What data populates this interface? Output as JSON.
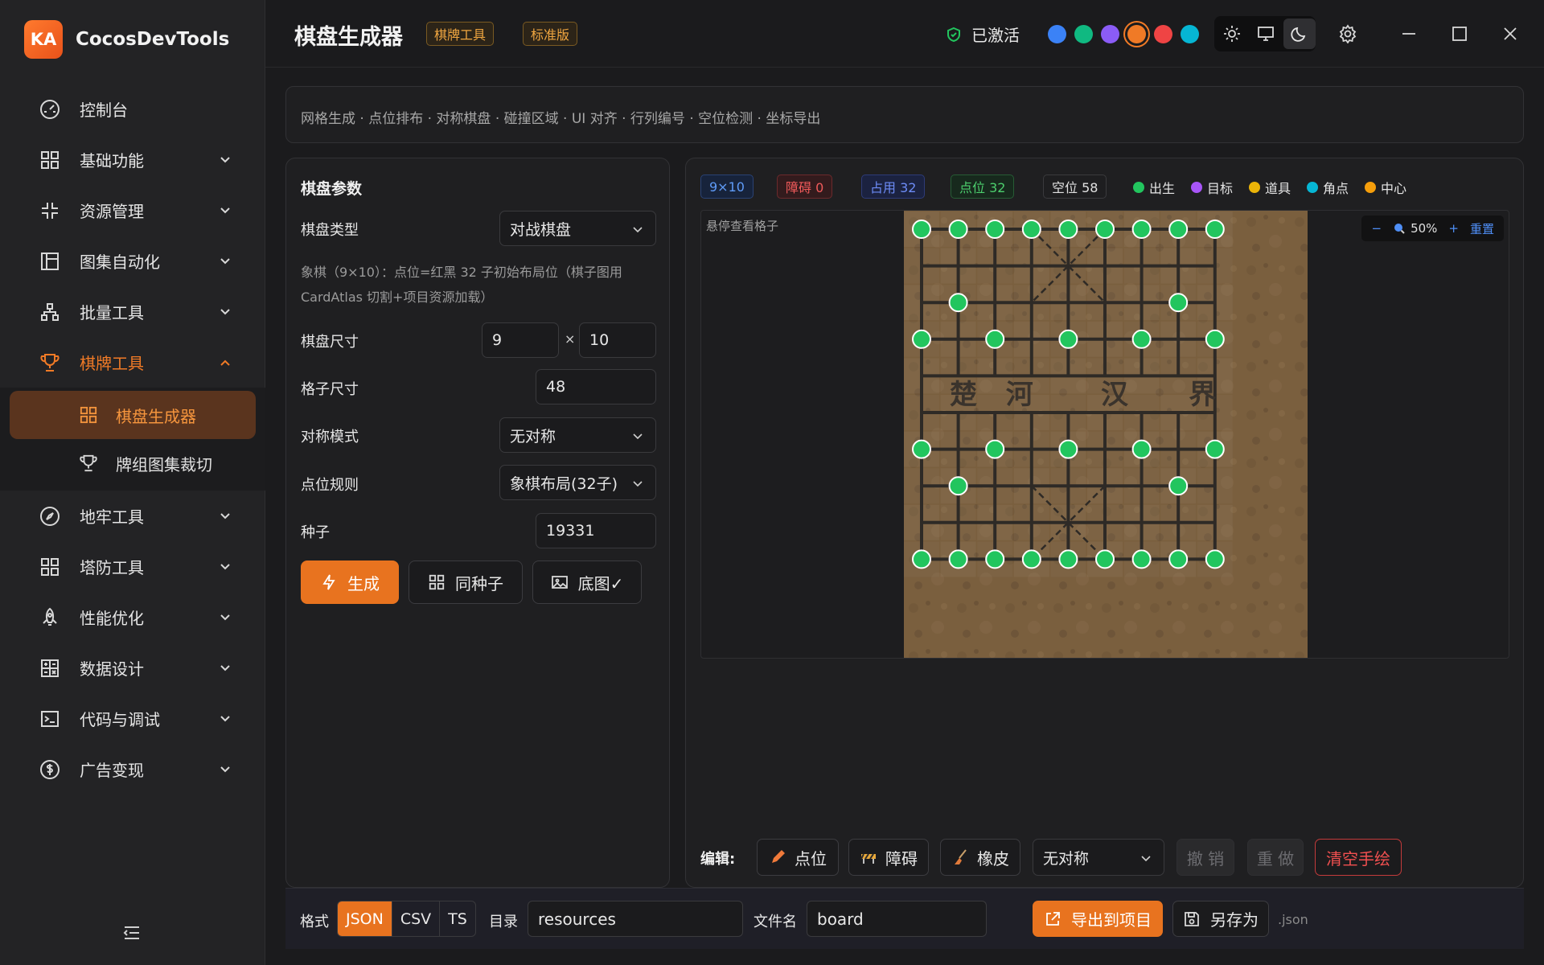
{
  "app": {
    "logo_text": "KA",
    "name": "CocosDevTools"
  },
  "sidebar": {
    "items": [
      {
        "label": "控制台",
        "icon": "dashboard-icon"
      },
      {
        "label": "基础功能",
        "icon": "grid-icon"
      },
      {
        "label": "资源管理",
        "icon": "shrink-icon"
      },
      {
        "label": "图集自动化",
        "icon": "layout-icon"
      },
      {
        "label": "批量工具",
        "icon": "hierarchy-icon"
      },
      {
        "label": "棋牌工具",
        "icon": "trophy-icon"
      },
      {
        "label": "地牢工具",
        "icon": "compass-icon"
      },
      {
        "label": "塔防工具",
        "icon": "grid-icon"
      },
      {
        "label": "性能优化",
        "icon": "rocket-icon"
      },
      {
        "label": "数据设计",
        "icon": "calculator-icon"
      },
      {
        "label": "代码与调试",
        "icon": "terminal-icon"
      },
      {
        "label": "广告变现",
        "icon": "dollar-icon"
      }
    ],
    "subitems": [
      {
        "label": "棋盘生成器",
        "icon": "grid-icon"
      },
      {
        "label": "牌组图集裁切",
        "icon": "trophy-icon"
      }
    ]
  },
  "header": {
    "title": "棋盘生成器",
    "tags": [
      "棋牌工具",
      "标准版"
    ],
    "status": "已激活",
    "swatches": [
      "#3b82f6",
      "#10b981",
      "#8b5cf6",
      "#f07a26",
      "#ef4444",
      "#06b6d4"
    ]
  },
  "features": "网格生成 · 点位排布 · 对称棋盘 · 碰撞区域 · UI 对齐 · 行列编号 · 空位检测 · 坐标导出",
  "params": {
    "title": "棋盘参数",
    "type_label": "棋盘类型",
    "type_value": "对战棋盘",
    "desc": "象棋（9×10）：点位=红黑 32 子初始布局位（棋子图用 CardAtlas 切割+项目资源加载）",
    "size_label": "棋盘尺寸",
    "size_w": "9",
    "size_x": "×",
    "size_h": "10",
    "cell_label": "格子尺寸",
    "cell_value": "48",
    "sym_label": "对称模式",
    "sym_value": "无对称",
    "rule_label": "点位规则",
    "rule_value": "象棋布局(32子)",
    "seed_label": "种子",
    "seed_value": "19331",
    "btn_generate": "生成",
    "btn_same_seed": "同种子",
    "btn_bg": "底图✓"
  },
  "stats": {
    "dims": "9×10",
    "obstacles": "障碍 0",
    "occupied": "占用 32",
    "points": "点位 32",
    "empty": "空位 58"
  },
  "legend": [
    {
      "label": "出生",
      "color": "#22c55e"
    },
    {
      "label": "目标",
      "color": "#a855f7"
    },
    {
      "label": "道具",
      "color": "#eab308"
    },
    {
      "label": "角点",
      "color": "#06b6d4"
    },
    {
      "label": "中心",
      "color": "#f59e0b"
    }
  ],
  "canvas": {
    "hover_hint": "悬停查看格子",
    "zoom_minus": "−",
    "zoom_value": "50%",
    "zoom_plus": "+",
    "zoom_reset": "重置",
    "river_text": [
      "楚",
      "河",
      "汉",
      "界"
    ]
  },
  "edit": {
    "label": "编辑:",
    "point": "点位",
    "obstacle": "障碍",
    "eraser": "橡皮",
    "symmetry": "无对称",
    "undo": "撤 销",
    "redo": "重 做",
    "clear": "清空手绘"
  },
  "export": {
    "format_label": "格式",
    "formats": [
      "JSON",
      "CSV",
      "TS"
    ],
    "dir_label": "目录",
    "dir_value": "resources",
    "file_label": "文件名",
    "file_value": "board",
    "export_btn": "导出到项目",
    "saveas_btn": "另存为",
    "ext": ".json"
  }
}
